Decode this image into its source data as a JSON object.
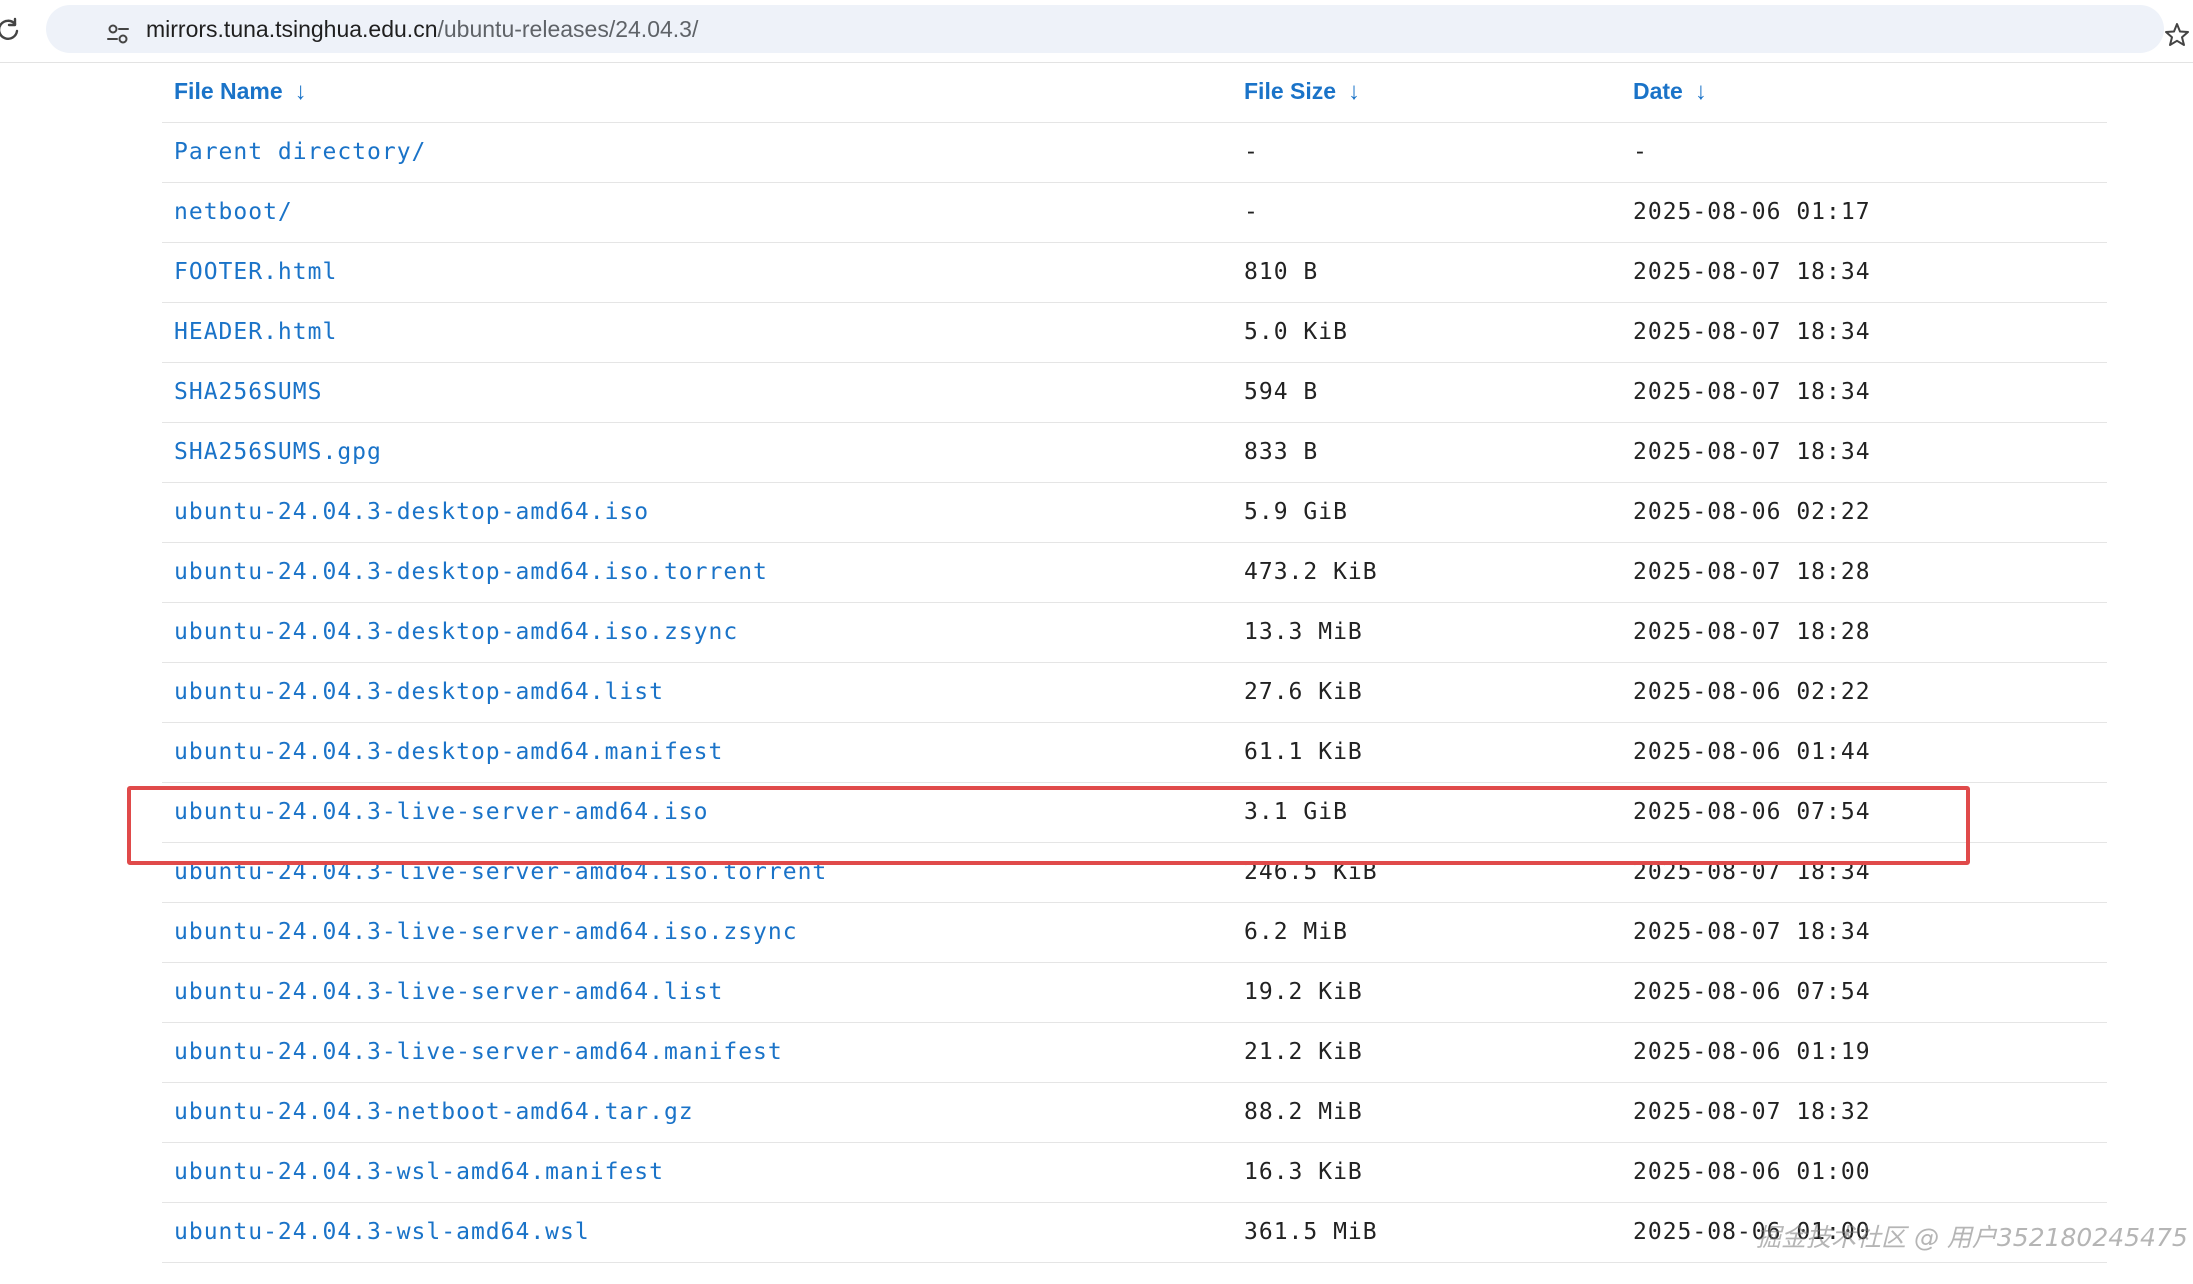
{
  "browser": {
    "url_host": "mirrors.tuna.tsinghua.edu.cn",
    "url_path": "/ubuntu-releases/24.04.3/",
    "icons": {
      "reload": "reload-icon",
      "site_info": "tune-icon",
      "bookmark": "star-icon"
    }
  },
  "table": {
    "headers": {
      "name": "File Name",
      "size": "File Size",
      "date": "Date",
      "arrow": "↓"
    },
    "rows": [
      {
        "name": "Parent directory/",
        "size": "-",
        "date": "-"
      },
      {
        "name": "netboot/",
        "size": "-",
        "date": "2025-08-06 01:17"
      },
      {
        "name": "FOOTER.html",
        "size": "810 B",
        "date": "2025-08-07 18:34"
      },
      {
        "name": "HEADER.html",
        "size": "5.0 KiB",
        "date": "2025-08-07 18:34"
      },
      {
        "name": "SHA256SUMS",
        "size": "594 B",
        "date": "2025-08-07 18:34"
      },
      {
        "name": "SHA256SUMS.gpg",
        "size": "833 B",
        "date": "2025-08-07 18:34"
      },
      {
        "name": "ubuntu-24.04.3-desktop-amd64.iso",
        "size": "5.9 GiB",
        "date": "2025-08-06 02:22"
      },
      {
        "name": "ubuntu-24.04.3-desktop-amd64.iso.torrent",
        "size": "473.2 KiB",
        "date": "2025-08-07 18:28"
      },
      {
        "name": "ubuntu-24.04.3-desktop-amd64.iso.zsync",
        "size": "13.3 MiB",
        "date": "2025-08-07 18:28"
      },
      {
        "name": "ubuntu-24.04.3-desktop-amd64.list",
        "size": "27.6 KiB",
        "date": "2025-08-06 02:22"
      },
      {
        "name": "ubuntu-24.04.3-desktop-amd64.manifest",
        "size": "61.1 KiB",
        "date": "2025-08-06 01:44"
      },
      {
        "name": "ubuntu-24.04.3-live-server-amd64.iso",
        "size": "3.1 GiB",
        "date": "2025-08-06 07:54"
      },
      {
        "name": "ubuntu-24.04.3-live-server-amd64.iso.torrent",
        "size": "246.5 KiB",
        "date": "2025-08-07 18:34"
      },
      {
        "name": "ubuntu-24.04.3-live-server-amd64.iso.zsync",
        "size": "6.2 MiB",
        "date": "2025-08-07 18:34"
      },
      {
        "name": "ubuntu-24.04.3-live-server-amd64.list",
        "size": "19.2 KiB",
        "date": "2025-08-06 07:54"
      },
      {
        "name": "ubuntu-24.04.3-live-server-amd64.manifest",
        "size": "21.2 KiB",
        "date": "2025-08-06 01:19"
      },
      {
        "name": "ubuntu-24.04.3-netboot-amd64.tar.gz",
        "size": "88.2 MiB",
        "date": "2025-08-07 18:32"
      },
      {
        "name": "ubuntu-24.04.3-wsl-amd64.manifest",
        "size": "16.3 KiB",
        "date": "2025-08-06 01:00"
      },
      {
        "name": "ubuntu-24.04.3-wsl-amd64.wsl",
        "size": "361.5 MiB",
        "date": "2025-08-06 01:00"
      }
    ]
  },
  "highlight": {
    "row": "ubuntu-24.04.3-live-server-amd64.iso",
    "color": "#e04a4a"
  },
  "watermark": {
    "text": "掘金技术社区 @ 用户352180245475"
  },
  "colors": {
    "link": "#1a73c8",
    "omnibox_bg": "#eef2f9",
    "row_border": "#e5e5e5"
  }
}
